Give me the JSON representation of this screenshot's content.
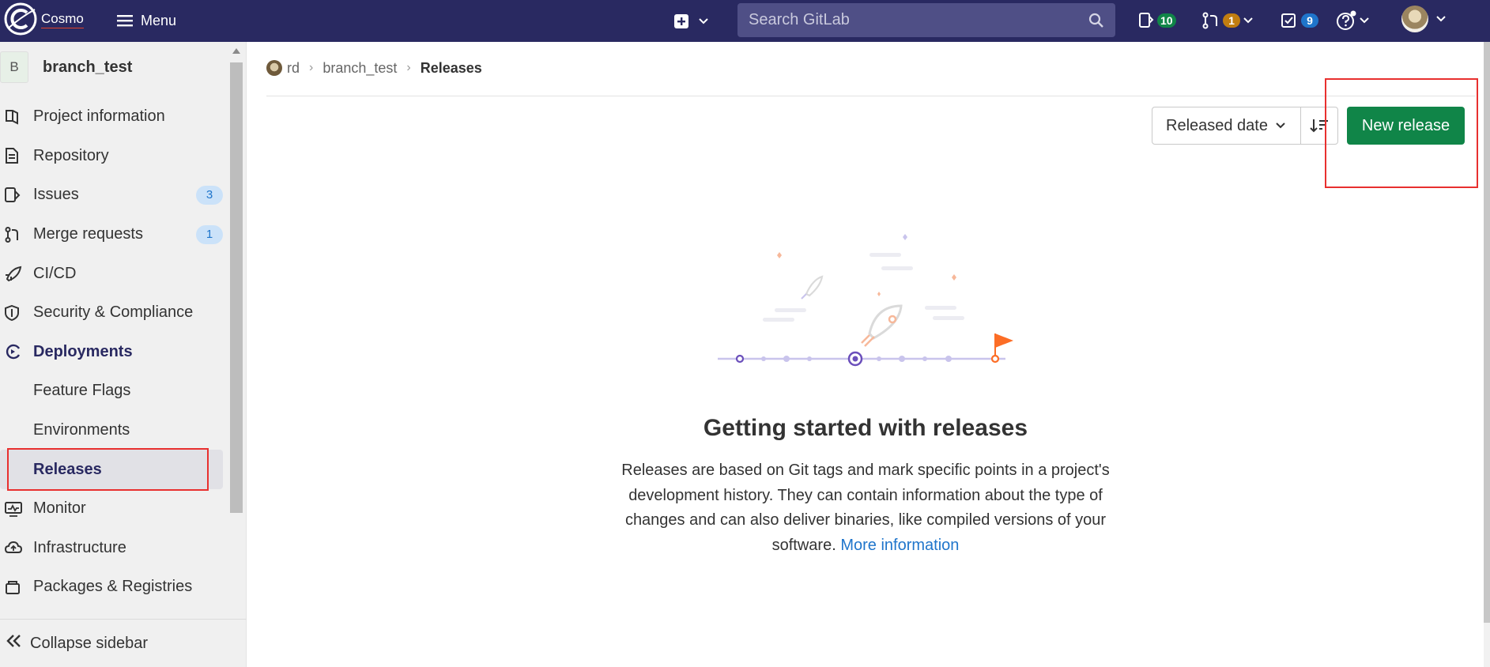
{
  "topbar": {
    "brand": "Cosmo",
    "menu_label": "Menu",
    "search_placeholder": "Search GitLab",
    "issues_count": "10",
    "mr_count": "1",
    "todo_count": "9"
  },
  "sidebar": {
    "project_initial": "B",
    "project_name": "branch_test",
    "items": [
      {
        "label": "Project information"
      },
      {
        "label": "Repository"
      },
      {
        "label": "Issues",
        "badge": "3"
      },
      {
        "label": "Merge requests",
        "badge": "1"
      },
      {
        "label": "CI/CD"
      },
      {
        "label": "Security & Compliance"
      },
      {
        "label": "Deployments"
      },
      {
        "label": "Feature Flags"
      },
      {
        "label": "Environments"
      },
      {
        "label": "Releases"
      },
      {
        "label": "Monitor"
      },
      {
        "label": "Infrastructure"
      },
      {
        "label": "Packages & Registries"
      }
    ],
    "collapse_label": "Collapse sidebar"
  },
  "breadcrumb": {
    "group": "rd",
    "project": "branch_test",
    "current": "Releases"
  },
  "toolbar": {
    "sort_label": "Released date",
    "new_release_label": "New release"
  },
  "empty_state": {
    "title": "Getting started with releases",
    "description": "Releases are based on Git tags and mark specific points in a project's development history. They can contain information about the type of changes and can also deliver binaries, like compiled versions of your software.",
    "link_text": "More information"
  },
  "colors": {
    "topbar": "#292961",
    "primary_button": "#108548",
    "annotation_box": "#e8302f",
    "link": "#1f75cb"
  }
}
